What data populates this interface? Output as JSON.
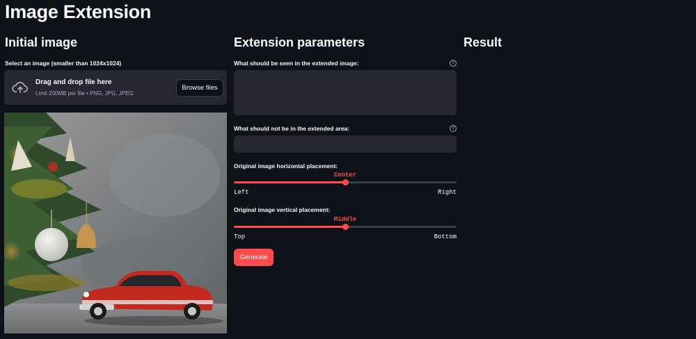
{
  "page": {
    "title": "Image Extension"
  },
  "colors": {
    "background": "#0e1117",
    "panel": "#262730",
    "accent": "#ff4b4b",
    "text": "#fafafa",
    "muted": "#a3a8b8"
  },
  "initial": {
    "heading": "Initial image",
    "uploader_label": "Select an image (smaller than 1024x1024)",
    "drop_title": "Drag and drop file here",
    "drop_sub": "Limit 200MB per file • PNG, JPG, JPEG",
    "browse_label": "Browse files",
    "upload_icon": "cloud-upload-icon"
  },
  "params": {
    "heading": "Extension parameters",
    "prompt_label": "What should be seen in the extended image:",
    "prompt_value": "",
    "negative_label": "What should not be in the extended area:",
    "negative_value": "",
    "help_icon": "question-circle-icon",
    "help_glyph": "?",
    "horizontal": {
      "label": "Original image horizontal placement:",
      "value": "Center",
      "fraction": 0.5,
      "min_label": "Left",
      "max_label": "Right"
    },
    "vertical": {
      "label": "Original image vertical placement:",
      "value": "Middle",
      "fraction": 0.5,
      "min_label": "Top",
      "max_label": "Bottom"
    },
    "generate_label": "Generate"
  },
  "result": {
    "heading": "Result"
  }
}
